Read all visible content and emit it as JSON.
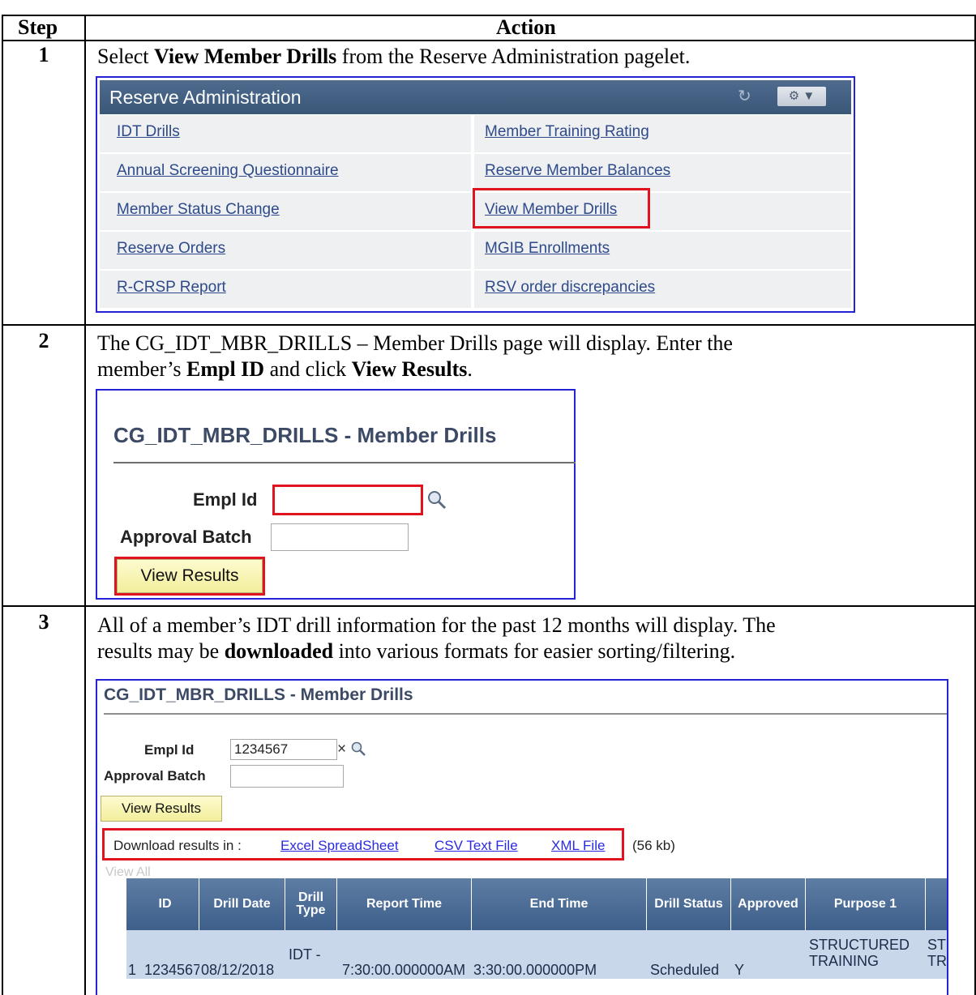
{
  "table": {
    "header_step": "Step",
    "header_action": "Action"
  },
  "steps": [
    {
      "number": "1",
      "text_parts": [
        "Select ",
        "View Member Drills",
        " from the Reserve Administration pagelet."
      ]
    },
    {
      "number": "2",
      "text_line1": "The CG_IDT_MBR_DRILLS – Member Drills page will display.  Enter the",
      "text_line2_parts": [
        "member’s ",
        "Empl ID",
        " and click ",
        "View Results",
        "."
      ]
    },
    {
      "number": "3",
      "text_line1": "All of a member’s IDT drill information for the past 12 months will display.  The",
      "text_line2_parts": [
        "results may be ",
        "downloaded",
        " into various formats for easier sorting/filtering."
      ]
    }
  ],
  "pagelet": {
    "title": "Reserve Administration",
    "refresh_icon": "refresh-icon",
    "gear_icon": "gear-icon",
    "links_left": [
      "IDT Drills",
      "Annual Screening Questionnaire",
      "Member Status Change",
      "Reserve Orders",
      "R-CRSP Report"
    ],
    "links_right": [
      "Member Training Rating",
      "Reserve Member Balances",
      "View Member Drills",
      "MGIB Enrollments",
      "RSV order discrepancies"
    ]
  },
  "panel2": {
    "title": "CG_IDT_MBR_DRILLS - Member Drills",
    "empl_label": "Empl Id",
    "empl_value": "",
    "batch_label": "Approval Batch",
    "batch_value": "",
    "button": "View Results"
  },
  "panel3": {
    "title": "CG_IDT_MBR_DRILLS - Member Drills",
    "empl_label": "Empl Id",
    "empl_value": "1234567",
    "clear_glyph": "×",
    "batch_label": "Approval Batch",
    "batch_value": "",
    "button": "View Results",
    "download_label": "Download results in :",
    "download_links": [
      "Excel SpreadSheet",
      "CSV Text File",
      "XML File"
    ],
    "download_size": "(56 kb)",
    "view_all": "View All",
    "columns": [
      "",
      "ID",
      "Drill Date",
      "Drill Type",
      "Report Time",
      "End Time",
      "Drill Status",
      "Approved",
      "Purpose 1",
      ""
    ],
    "row": [
      "1",
      "1234567",
      "08/12/2018",
      "IDT -",
      "7:30:00.000000AM",
      "3:30:00.000000PM",
      "Scheduled",
      "Y",
      "STRUCTURED TRAINING",
      "ST TR"
    ]
  },
  "colors": {
    "highlight_red": "#e0141e",
    "panel_border_blue": "#2424d6",
    "pagelet_header": "#4e6b8e",
    "link_blue": "#2e4a8a"
  }
}
